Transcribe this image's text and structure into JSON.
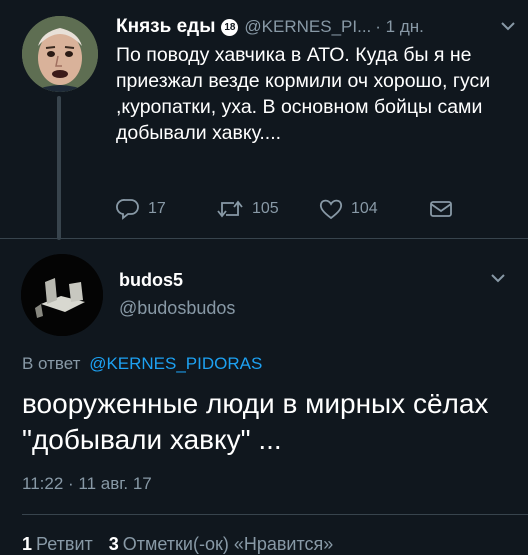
{
  "tweet1": {
    "author_name": "Князь еды",
    "badge": "18",
    "handle": "@KERNES_PI...",
    "time": "· 1 дн.",
    "text": "По поводу хавчика в АТО.  Куда бы я не приезжал везде кормили оч хорошо, гуси ,куропатки, уха. В основном бойцы сами добывали хавку....",
    "replies": "17",
    "retweets": "105",
    "likes": "104"
  },
  "tweet2": {
    "author_name": "budos5",
    "handle": "@budosbudos",
    "reply_label": "В ответ",
    "reply_to": "@KERNES_PIDORAS",
    "text": "вооруженные люди в мирных сёлах \"добывали хавку\" ...",
    "datetime": "11:22 · 11 авг. 17",
    "retweets_count": "1",
    "retweets_label": "Ретвит",
    "likes_count": "3",
    "likes_label": "Отметки(-ок) «Нравится»"
  },
  "colors": {
    "background": "#10171e",
    "accent": "#1da1f2",
    "muted": "#8899a6",
    "divider": "#38444d"
  },
  "icons": [
    "reply-icon",
    "retweet-icon",
    "like-icon",
    "dm-icon",
    "chevron-down-icon"
  ]
}
